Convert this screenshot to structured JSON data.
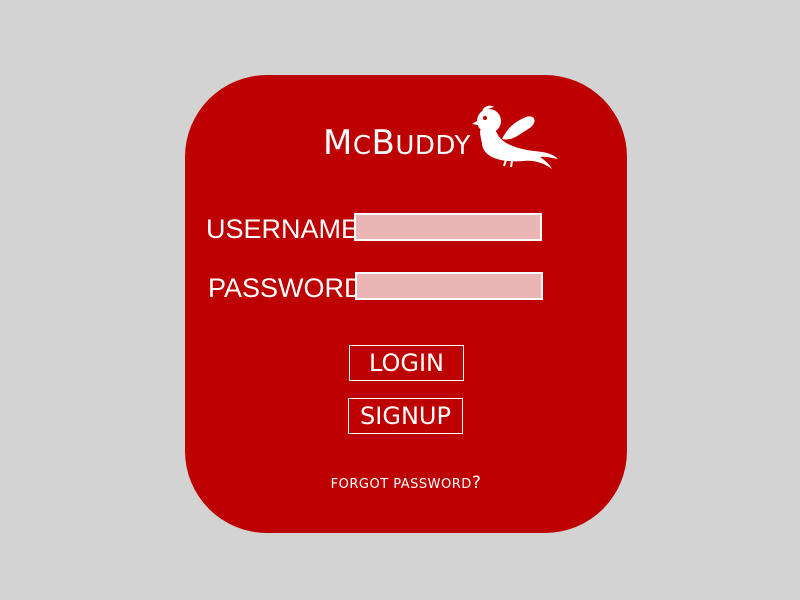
{
  "brand": {
    "name_initial_1": "M",
    "name_small_1": "C",
    "name_initial_2": "B",
    "name_small_2": "UDDY",
    "logo_icon": "bird-icon"
  },
  "form": {
    "username_label": "USERNAME",
    "username_value": "",
    "password_label": "PASSWORD",
    "password_value": ""
  },
  "actions": {
    "login_label": "LOGIN",
    "signup_label": "SIGNUP",
    "forgot_label": "FORGOT PASSWORD",
    "forgot_question_mark": "?"
  },
  "colors": {
    "background": "#d3d3d3",
    "card": "#bd0000",
    "input_fill": "#ecb5b5",
    "text": "#ffffff"
  }
}
